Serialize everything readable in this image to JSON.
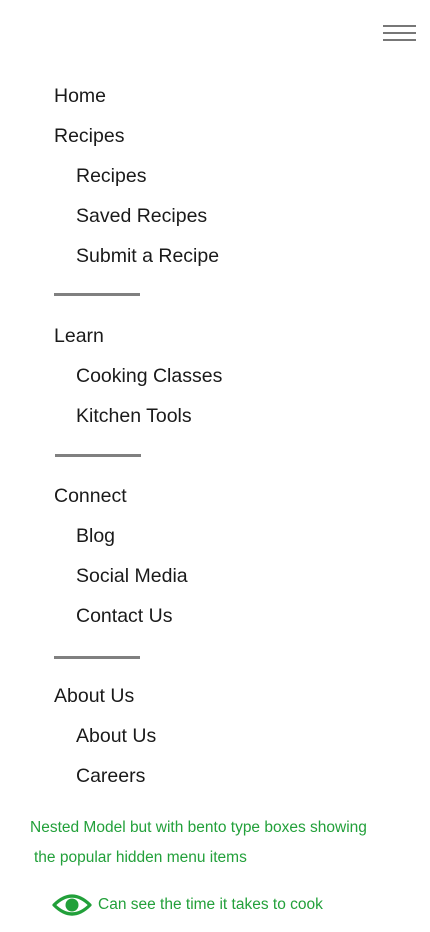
{
  "header": {
    "menu_icon": "hamburger-menu-icon"
  },
  "menu": {
    "home": "Home",
    "recipes": {
      "label": "Recipes",
      "items": [
        "Recipes",
        "Saved Recipes",
        "Submit a Recipe"
      ]
    },
    "learn": {
      "label": "Learn",
      "items": [
        "Cooking Classes",
        "Kitchen Tools"
      ]
    },
    "connect": {
      "label": "Connect",
      "items": [
        "Blog",
        "Social Media",
        "Contact Us"
      ]
    },
    "about": {
      "label": "About Us",
      "items": [
        "About Us",
        "Careers"
      ]
    }
  },
  "annotations": {
    "note_line1": "Nested Model but with bento type boxes showing",
    "note_line2": "the popular hidden menu items",
    "eye_note": "Can see the time it takes to cook",
    "eye_icon": "eye-icon",
    "note_color": "#22a03a"
  }
}
